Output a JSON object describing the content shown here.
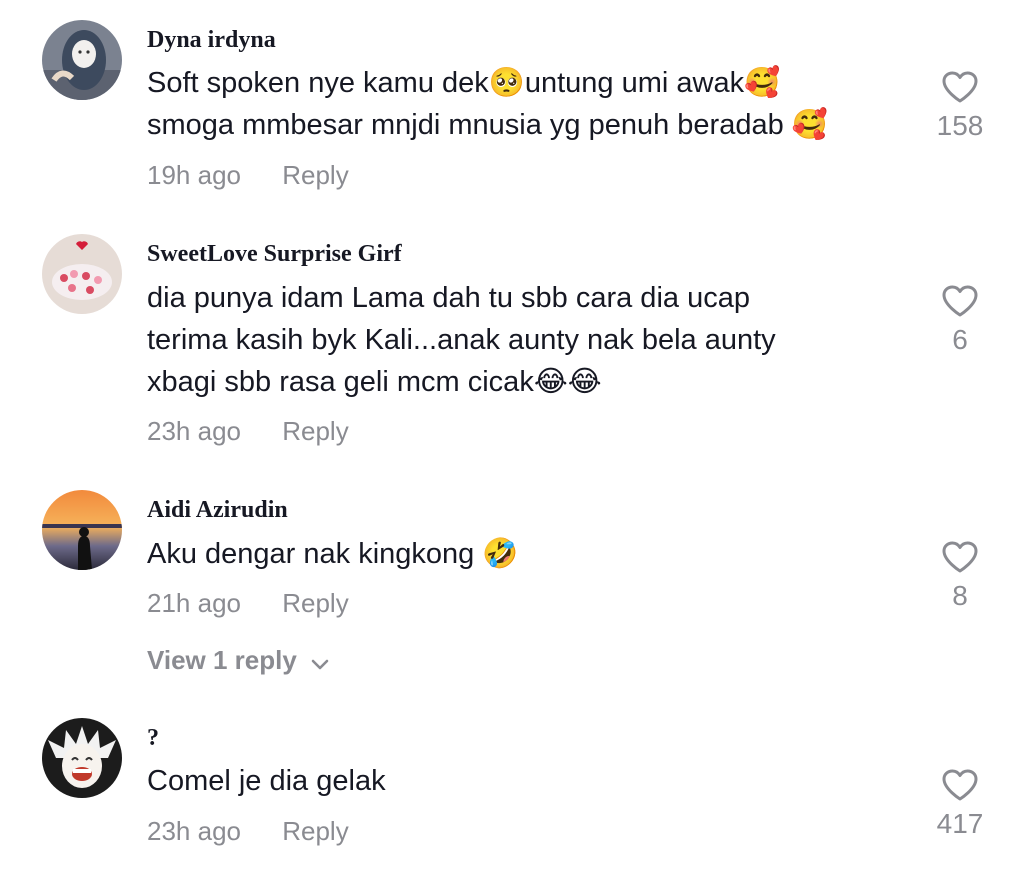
{
  "comments": [
    {
      "username": "Dyna irdyna",
      "lines": [
        "Soft spoken nye kamu dek🥺untung umi awak🥰",
        "smoga mmbesar mnjdi mnusia yg penuh beradab 🥰"
      ],
      "time": "19h ago",
      "reply_label": "Reply",
      "likes": "158"
    },
    {
      "username": "SweetLove Surprise Girf",
      "lines": [
        "dia punya idam Lama dah tu sbb cara dia ucap",
        "terima kasih byk Kali...anak aunty nak bela aunty",
        "xbagi sbb rasa geli mcm cicak😂😂"
      ],
      "time": "23h ago",
      "reply_label": "Reply",
      "likes": "6"
    },
    {
      "username": "Aidi Azirudin",
      "lines": [
        "Aku dengar nak kingkong 🤣"
      ],
      "time": "21h ago",
      "reply_label": "Reply",
      "likes": "8",
      "view_replies": "View 1 reply"
    },
    {
      "username": "?",
      "lines": [
        "Comel je dia gelak"
      ],
      "time": "23h ago",
      "reply_label": "Reply",
      "likes": "417"
    }
  ],
  "icons": {
    "like": "heart-outline-icon",
    "expand": "chevron-down-icon"
  },
  "colors": {
    "text": "#161823",
    "muted": "#8a8b91",
    "background": "#ffffff"
  }
}
